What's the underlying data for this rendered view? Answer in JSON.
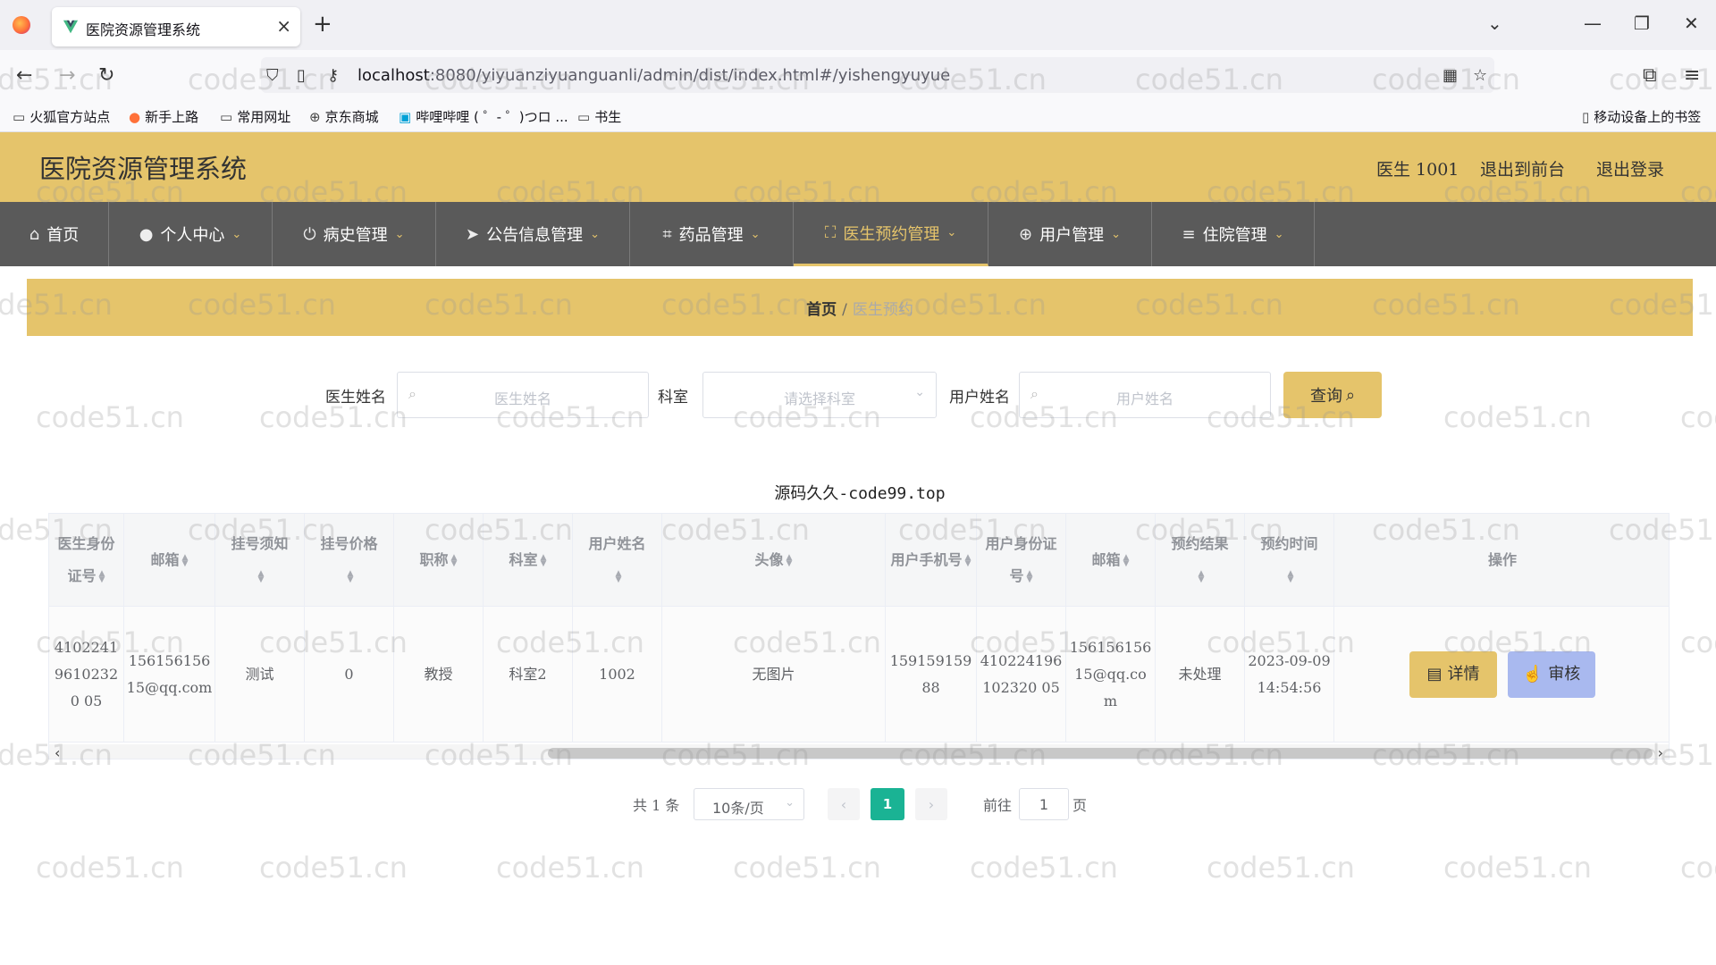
{
  "browser": {
    "tab_title": "医院资源管理系统",
    "url_host": "localhost",
    "url_rest": ":8080/yiyuanziyuanguanli/admin/dist/index.html#/yishengyuyue",
    "bookmarks": [
      {
        "label": "火狐官方站点",
        "icon": "folder-icon"
      },
      {
        "label": "新手上路",
        "icon": "firefox-icon"
      },
      {
        "label": "常用网址",
        "icon": "folder-icon"
      },
      {
        "label": "京东商城",
        "icon": "globe-icon"
      },
      {
        "label": "哔哩哔哩 ( ゜- ゜)つロ ...",
        "icon": "bilibili-icon"
      },
      {
        "label": "书生",
        "icon": "folder-icon"
      }
    ],
    "mobile_bookmarks": "移动设备上的书签"
  },
  "header": {
    "title": "医院资源管理系统",
    "user": "医生 1001",
    "to_front": "退出到前台",
    "logout": "退出登录"
  },
  "nav": {
    "items": [
      {
        "label": "首页",
        "icon": "home-icon"
      },
      {
        "label": "个人中心",
        "icon": "user-icon"
      },
      {
        "label": "病史管理",
        "icon": "power-icon"
      },
      {
        "label": "公告信息管理",
        "icon": "send-icon"
      },
      {
        "label": "药品管理",
        "icon": "crop-icon"
      },
      {
        "label": "医生预约管理",
        "icon": "fullscreen-icon"
      },
      {
        "label": "用户管理",
        "icon": "target-icon"
      },
      {
        "label": "住院管理",
        "icon": "menu-icon"
      }
    ],
    "active_index": 5
  },
  "breadcrumb": {
    "home": "首页",
    "separator": "/",
    "current": "医生预约"
  },
  "search": {
    "doctor_label": "医生姓名",
    "doctor_placeholder": "医生姓名",
    "dept_label": "科室",
    "dept_placeholder": "请选择科室",
    "user_label": "用户姓名",
    "user_placeholder": "用户姓名",
    "query_button": "查询"
  },
  "table": {
    "title": "源码久久-code99.top",
    "headers": [
      "医生身份证号",
      "邮箱",
      "挂号须知",
      "挂号价格",
      "职称",
      "科室",
      "用户姓名",
      "头像",
      "用户手机号",
      "用户身份证号",
      "邮箱",
      "预约结果",
      "预约时间",
      "操作"
    ],
    "rows": [
      [
        "410224196102320 05",
        "15615615615@qq.com",
        "测试",
        "0",
        "教授",
        "科室2",
        "1002",
        "无图片",
        "15915915988",
        "410224196102320 05",
        "15615615615@qq.com",
        "未处理",
        "2023-09-09 14:54:56"
      ]
    ],
    "detail_button": "详情",
    "audit_button": "审核"
  },
  "pagination": {
    "total": "共 1 条",
    "page_size": "10条/页",
    "current_page": "1",
    "goto_label": "前往",
    "goto_value": "1",
    "page_unit": "页"
  },
  "watermark": "code51.cn"
}
